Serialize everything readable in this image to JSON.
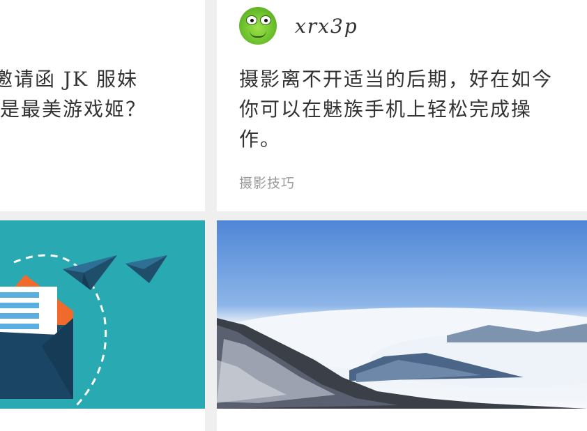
{
  "left_card": {
    "title_line1": "邀请函 JK 服妹",
    "title_line2": "是最美游戏姬？"
  },
  "right_card": {
    "author": "xrx3p",
    "title": "摄影离不开适当的后期，好在如今你可以在魅族手机上轻松完成操作。",
    "tag": "摄影技巧"
  },
  "images": {
    "left": "envelope-paper-planes-illustration",
    "right": "mountain-sea-of-clouds-photo"
  },
  "colors": {
    "background": "#efefef",
    "teal": "#29a9b2",
    "envelope_navy": "#1f4e6b",
    "envelope_orange": "#f06a2b"
  }
}
